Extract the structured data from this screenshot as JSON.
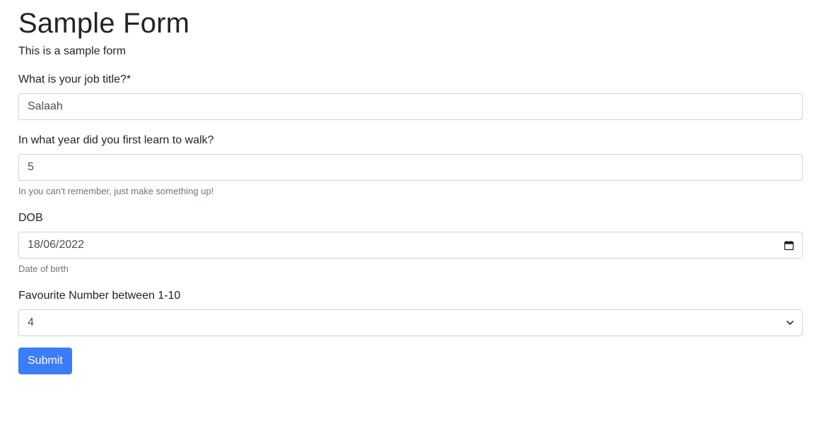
{
  "page": {
    "title": "Sample Form",
    "description": "This is a sample form"
  },
  "form": {
    "job_title": {
      "label": "What is your job title?*",
      "value": "Salaah"
    },
    "walk_year": {
      "label": "In what year did you first learn to walk?",
      "value": "5",
      "help": "In you can't remember, just make something up!"
    },
    "dob": {
      "label": "DOB",
      "value": "18/06/2022",
      "help": "Date of birth",
      "icon": "calendar-icon"
    },
    "favourite_number": {
      "label": "Favourite Number between 1-10",
      "value": "4",
      "icon": "chevron-down-icon"
    },
    "submit_label": "Submit"
  },
  "colors": {
    "primary": "#3b7df8",
    "border": "#ced4da",
    "help_text": "#6c757d"
  }
}
